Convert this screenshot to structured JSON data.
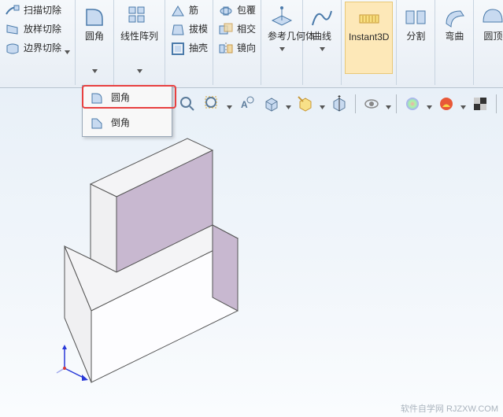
{
  "ribbon": {
    "col1": [
      {
        "label": "扫描切除"
      },
      {
        "label": "放样切除"
      },
      {
        "label": "边界切除"
      }
    ],
    "fillet": {
      "label": "圆角"
    },
    "linpat": {
      "label": "线性阵列"
    },
    "col3": [
      {
        "label": "筋"
      },
      {
        "label": "拔模"
      },
      {
        "label": "抽壳"
      }
    ],
    "col4": [
      {
        "label": "包覆"
      },
      {
        "label": "相交"
      },
      {
        "label": "镜向"
      }
    ],
    "refgeom": {
      "label": "参考几何体"
    },
    "curve": {
      "label": "曲线"
    },
    "instant": {
      "label": "Instant3D"
    },
    "split": {
      "label": "分割"
    },
    "bend": {
      "label": "弯曲"
    },
    "dome": {
      "label": "圆顶"
    }
  },
  "dropdown": {
    "item1": "圆角",
    "item2": "倒角"
  },
  "watermark": "软件自学网  RJZXW.COM"
}
